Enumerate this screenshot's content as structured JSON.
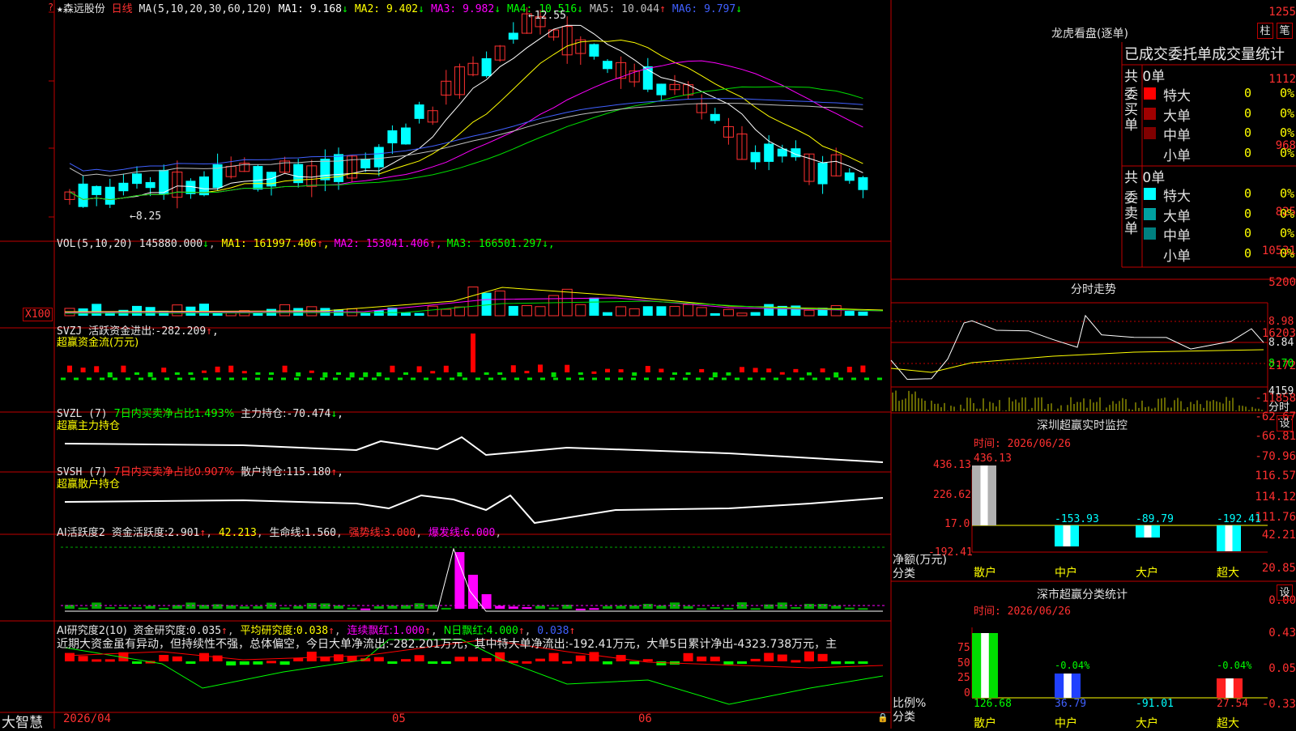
{
  "stock": {
    "star": "★",
    "name": "森远股份",
    "period": "日线"
  },
  "main_chart": {
    "ma_label": "MA(5,10,20,30,60,120)",
    "ma": [
      {
        "label": "MA1:",
        "value": "9.168",
        "arrow": "↓",
        "color": "#ffffff"
      },
      {
        "label": "MA2:",
        "value": "9.402",
        "arrow": "↓",
        "color": "#ffff00"
      },
      {
        "label": "MA3:",
        "value": "9.982",
        "arrow": "↓",
        "color": "#ff00ff"
      },
      {
        "label": "MA4:",
        "value": "10.516",
        "arrow": "↓",
        "color": "#00ff00"
      },
      {
        "label": "MA5:",
        "value": "10.044",
        "arrow": "↑",
        "color": "#c0c0c0"
      },
      {
        "label": "MA6:",
        "value": "9.797",
        "arrow": "↓",
        "color": "#4060ff"
      }
    ],
    "y_labels": [
      "1255",
      "1112",
      "968",
      "825"
    ],
    "high_mark": "12.55",
    "low_mark": "8.25"
  },
  "vol": {
    "label": "VOL(5,10,20)",
    "value": "145880.000",
    "arrow": "↓",
    "ma": [
      {
        "label": "MA1:",
        "value": "161997.406",
        "arrow": "↑",
        "color": "#ffff00"
      },
      {
        "label": "MA2:",
        "value": "153041.406",
        "arrow": "↑",
        "color": "#ff00ff"
      },
      {
        "label": "MA3:",
        "value": "166501.297",
        "arrow": "↓",
        "color": "#00ff00"
      }
    ],
    "y_labels": [
      "10531",
      "5200"
    ],
    "unit": "X100"
  },
  "svzj": {
    "code": "SVZJ",
    "label": "活跃资金进出:",
    "value": "-282.209",
    "arrow": "↑",
    "sep": ",",
    "sub": "超赢资金流(万元)",
    "y_labels": [
      "16203",
      "2172",
      "-11858"
    ]
  },
  "svzl": {
    "code": "SVZL (7)",
    "pct_label": "7日内买卖净占比1.493%",
    "hold_label": "主力持仓:",
    "value": "-70.474",
    "arrow": "↓",
    "sep": ",",
    "sub": "超赢主力持仓",
    "y_labels": [
      "-62.67",
      "-66.81",
      "-70.96"
    ]
  },
  "svsh": {
    "code": "SVSH (7)",
    "pct_label": "7日内买卖净占比0.907%",
    "hold_label": "散户持仓:",
    "value": "115.180",
    "arrow": "↑",
    "sep": ",",
    "sub": "超赢散户持仓",
    "y_labels": [
      "116.57",
      "114.12",
      "111.76"
    ]
  },
  "ai_active": {
    "code": "AI活跃度2",
    "l1": "资金活跃度:",
    "v1": "2.901",
    "a1": "↑",
    "v2": "42.213",
    "l3": "生命线:",
    "v3": "1.560",
    "l4": "强势线:",
    "v4": "3.000",
    "l5": "爆发线:",
    "v5": "6.000",
    "y_labels": [
      "42.21",
      "20.85",
      "0.00"
    ]
  },
  "ai_research": {
    "code": "AI研究度2(10)",
    "l1": "资金研究度:",
    "v1": "0.035",
    "a1": "↑",
    "l2": "平均研究度:",
    "v2": "0.038",
    "a2": "↑",
    "l3": "连续飘红:",
    "v3": "1.000",
    "a3": "↑",
    "l4": "N日飘红:",
    "v4": "4.000",
    "a4": "↑",
    "v5": "0.038",
    "a5": "↑",
    "comment": "近期大资金虽有异动，但持续性不强，总体偏空，今日大单净流出:-282.201万元，其中特大单净流出:-192.41万元，大单5日累计净出-4323.738万元，主",
    "y_labels": [
      "0.43",
      "0.05",
      "-0.33"
    ]
  },
  "x_axis": {
    "labels": [
      "2026/04",
      "05",
      "06"
    ],
    "brand": "大智慧"
  },
  "right": {
    "dragon": {
      "title": "龙虎看盘(逐单)",
      "btn1": "柱",
      "btn2": "笔",
      "header": "已成交委托单成交量统计",
      "buy": {
        "label": "委买单",
        "total": "共 0单",
        "rows": [
          {
            "name": "特大",
            "val": "0",
            "pct": "0%",
            "color": "#ff0000"
          },
          {
            "name": "大单",
            "val": "0",
            "pct": "0%",
            "color": "#a00000"
          },
          {
            "name": "中单",
            "val": "0",
            "pct": "0%",
            "color": "#800000"
          },
          {
            "name": "小单",
            "val": "0",
            "pct": "0%",
            "color": ""
          }
        ]
      },
      "sell": {
        "label": "委卖单",
        "total": "共 0单",
        "rows": [
          {
            "name": "特大",
            "val": "0",
            "pct": "0%",
            "color": "#00ffff"
          },
          {
            "name": "大单",
            "val": "0",
            "pct": "0%",
            "color": "#00a0a0"
          },
          {
            "name": "中单",
            "val": "0",
            "pct": "0%",
            "color": "#008080"
          },
          {
            "name": "小单",
            "val": "0",
            "pct": "0%",
            "color": ""
          }
        ]
      }
    },
    "intraday": {
      "title": "分时走势",
      "y_labels": [
        "8.98",
        "8.84",
        "8.70"
      ],
      "vol_label": "4159",
      "vol_unit": "分时"
    },
    "sz_monitor": {
      "title": "深圳超赢实时监控",
      "btn": "设",
      "time": "时间: 2026/06/26",
      "y_labels": [
        "436.13",
        "226.62",
        "17.0",
        "-192.41"
      ],
      "y_title": "净额(万元)",
      "x_title": "分类",
      "bars": [
        {
          "cat": "散户",
          "val": "436.13"
        },
        {
          "cat": "中户",
          "val": "-153.93"
        },
        {
          "cat": "大户",
          "val": "-89.79"
        },
        {
          "cat": "超大",
          "val": "-192.41"
        }
      ]
    },
    "sz_class": {
      "title": "深市超赢分类统计",
      "btn": "设",
      "time": "时间: 2026/06/26",
      "y_labels": [
        "75",
        "50",
        "25",
        "0"
      ],
      "y_title": "比例%",
      "x_title": "分类",
      "bars": [
        {
          "cat": "散户",
          "val": "126.68",
          "top": ""
        },
        {
          "cat": "中户",
          "val": "36.79",
          "top": "-0.04%"
        },
        {
          "cat": "大户",
          "val": "-91.01",
          "top": ""
        },
        {
          "cat": "超大",
          "val": "27.54",
          "top": "-0.04%"
        }
      ]
    }
  }
}
